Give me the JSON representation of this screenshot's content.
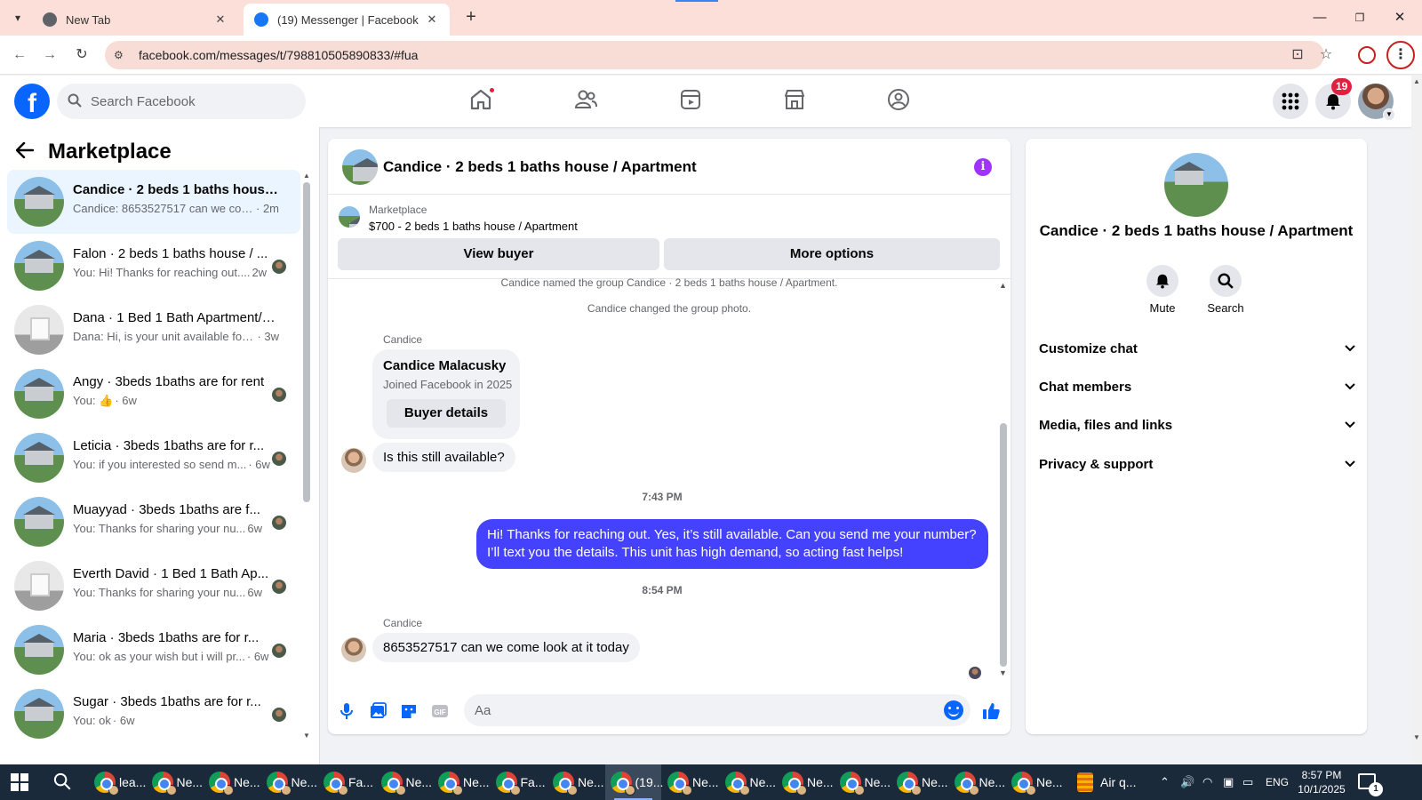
{
  "browser": {
    "tabs": [
      {
        "title": "New Tab"
      },
      {
        "title": "(19) Messenger | Facebook"
      }
    ],
    "url": "facebook.com/messages/t/798810505890833/#fua"
  },
  "fb_nav": {
    "search_placeholder": "Search Facebook",
    "notification_count": "19",
    "nav_icons": [
      "home-icon",
      "friends-icon",
      "video-icon",
      "marketplace-icon",
      "groups-icon"
    ]
  },
  "sidebar": {
    "title": "Marketplace",
    "conversations": [
      {
        "name": "Candice · 2 beds 1 baths house /...",
        "preview": "Candice: 8653527517 can we com...",
        "time": "· 2m",
        "thumb": "house"
      },
      {
        "name": "Falon · 2 beds 1 baths house / ...",
        "preview": "You: Hi! Thanks for reaching out....",
        "time": "2w",
        "thumb": "house"
      },
      {
        "name": "Dana · 1 Bed 1 Bath Apartment/c...",
        "preview": "Dana: Hi, is your unit available for ...",
        "time": "· 3w",
        "thumb": "room"
      },
      {
        "name": "Angy · 3beds 1baths are for rent",
        "preview": "You: 👍",
        "time": "· 6w",
        "thumb": "house"
      },
      {
        "name": "Leticia · 3beds 1baths are for r...",
        "preview": "You: if you interested so send m...",
        "time": "· 6w",
        "thumb": "house"
      },
      {
        "name": "Muayyad · 3beds 1baths are f...",
        "preview": "You: Thanks for sharing your nu...",
        "time": "6w",
        "thumb": "house"
      },
      {
        "name": "Everth David · 1 Bed 1 Bath Ap...",
        "preview": "You: Thanks for sharing your nu...",
        "time": "6w",
        "thumb": "room"
      },
      {
        "name": "Maria · 3beds 1baths are for r...",
        "preview": "You: ok as your wish but i will pr...",
        "time": "· 6w",
        "thumb": "house"
      },
      {
        "name": "Sugar · 3beds 1baths are for r...",
        "preview": "You: ok",
        "time": "· 6w",
        "thumb": "house"
      }
    ]
  },
  "chat": {
    "title": "Candice · 2 beds 1 baths house / Apartment",
    "marketplace_label": "Marketplace",
    "listing": "$700 - 2 beds 1 baths house / Apartment",
    "view_buyer": "View buyer",
    "more_options": "More options",
    "system_1": "Candice named the group Candice · 2 beds 1 baths house / Apartment.",
    "system_2": "Candice changed the group photo.",
    "sender_1": "Candice",
    "card_name": "Candice Malacusky",
    "card_joined": "Joined Facebook in 2025",
    "card_button": "Buyer details",
    "msg_in_1": "Is this still available?",
    "time_1": "7:43 PM",
    "msg_out_1": "Hi! Thanks for reaching out. Yes, it’s still available. Can you send me your number? I’ll text you the details. This unit has high demand, so acting fast helps!",
    "time_2": "8:54 PM",
    "sender_2": "Candice",
    "msg_in_2": "8653527517 can we come look at it today",
    "composer_placeholder": "Aa"
  },
  "info_panel": {
    "title": "Candice · 2 beds 1 baths house / Apartment",
    "mute_label": "Mute",
    "search_label": "Search",
    "sections": [
      "Customize chat",
      "Chat members",
      "Media, files and links",
      "Privacy & support"
    ]
  },
  "taskbar": {
    "apps": [
      "lea...",
      "Ne...",
      "Ne...",
      "Ne...",
      "Fa...",
      "Ne...",
      "Ne...",
      "Fa...",
      "Ne...",
      "(19...",
      "Ne...",
      "Ne...",
      "Ne...",
      "Ne...",
      "Ne...",
      "Ne...",
      "Ne..."
    ],
    "weather": "Air q...",
    "language": "ENG",
    "time": "8:57 PM",
    "date": "10/1/2025",
    "notifications": "1"
  },
  "colors": {
    "fb_blue": "#0866ff",
    "outgoing_bubble": "#4542ff",
    "badge_red": "#e41e3f",
    "info_purple": "#a033ff",
    "tab_bar": "#fcdfd8"
  }
}
